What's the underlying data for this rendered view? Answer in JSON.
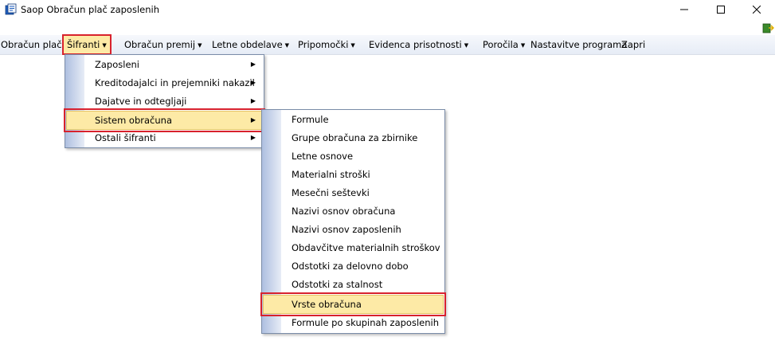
{
  "window": {
    "title": "Saop Obračun plač zaposlenih",
    "controls": [
      "minimize",
      "maximize",
      "close"
    ]
  },
  "menubar": {
    "items": [
      {
        "label": "Obračun plač",
        "has_arrow": false
      },
      {
        "label": "Šifranti",
        "has_arrow": true,
        "highlighted": true
      },
      {
        "label": "Obračun premij",
        "has_arrow": true
      },
      {
        "label": "Letne obdelave",
        "has_arrow": true
      },
      {
        "label": "Pripomočki",
        "has_arrow": true
      },
      {
        "label": "Evidenca prisotnosti",
        "has_arrow": true
      },
      {
        "label": "Poročila",
        "has_arrow": true
      },
      {
        "label": "Nastavitve programa",
        "has_arrow": false
      },
      {
        "label": "Zapri",
        "has_arrow": false
      }
    ]
  },
  "sifranti_menu": {
    "items": [
      {
        "label": "Zaposleni",
        "has_submenu": true
      },
      {
        "label": "Kreditodajalci in prejemniki nakazil",
        "has_submenu": true
      },
      {
        "label": "Dajatve in odtegljaji",
        "has_submenu": true
      },
      {
        "label": "Sistem obračuna",
        "has_submenu": true,
        "selected": true
      },
      {
        "label": "Ostali šifranti",
        "has_submenu": true
      }
    ]
  },
  "sistem_obracuna_menu": {
    "items": [
      {
        "label": "Formule"
      },
      {
        "label": "Grupe obračuna za zbirnike"
      },
      {
        "label": "Letne osnove"
      },
      {
        "label": "Materialni stroški"
      },
      {
        "label": "Mesečni seštevki"
      },
      {
        "label": "Nazivi osnov obračuna"
      },
      {
        "label": "Nazivi osnov zaposlenih"
      },
      {
        "label": "Obdavčitve materialnih stroškov"
      },
      {
        "label": "Odstotki za delovno dobo"
      },
      {
        "label": "Odstotki za stalnost"
      },
      {
        "label": "Vrste obračuna",
        "selected": true
      },
      {
        "label": "Formule po skupinah zaposlenih"
      }
    ]
  },
  "colors": {
    "highlight": "#fdeaa6",
    "red_outline": "#d8222d",
    "menubar_bg": "#e6ecf6"
  }
}
